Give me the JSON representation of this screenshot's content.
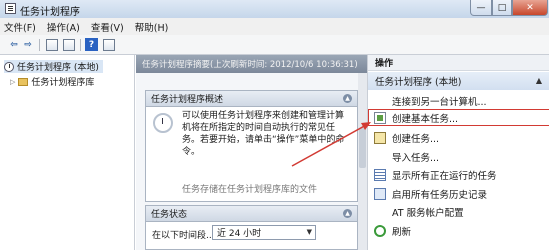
{
  "window": {
    "title": "任务计划程序",
    "buttons": {
      "minimize": "—",
      "maximize": "□",
      "close": "✕"
    }
  },
  "menu": [
    "文件(F)",
    "操作(A)",
    "查看(V)",
    "帮助(H)"
  ],
  "toolbar": {
    "back": "⇦",
    "forward": "⇨",
    "help": "?"
  },
  "tree": {
    "root": "任务计划程序 (本地)",
    "library": "任务计划程序库"
  },
  "center": {
    "header": "任务计划程序摘要(上次刷新时间: 2012/10/6 10:36:31)",
    "overview": {
      "title": "任务计划程序概述",
      "text": "可以使用任务计划程序来创建和管理计算机将在所指定的时间自动执行的常见任务。若要开始，请单击“操作”菜单中的命令。",
      "trailing": "任务存储在任务计划程序库的文件"
    },
    "status": {
      "title": "任务状态",
      "label": "在以下时间段...",
      "select_value": "近 24 小时"
    }
  },
  "actions": {
    "title": "操作",
    "group": "任务计划程序 (本地)",
    "items": [
      "连接到另一台计算机...",
      "创建基本任务...",
      "创建任务...",
      "导入任务...",
      "显示所有正在运行的任务",
      "启用所有任务历史记录",
      "AT 服务帐户配置",
      "刷新"
    ]
  },
  "colors": {
    "highlight": "#d23a33",
    "header": "#8a95a5"
  },
  "icons": [
    "clock-icon",
    "folder-icon",
    "wizard-icon",
    "create-task-icon",
    "import-icon",
    "list-icon",
    "history-icon",
    "refresh-icon"
  ]
}
